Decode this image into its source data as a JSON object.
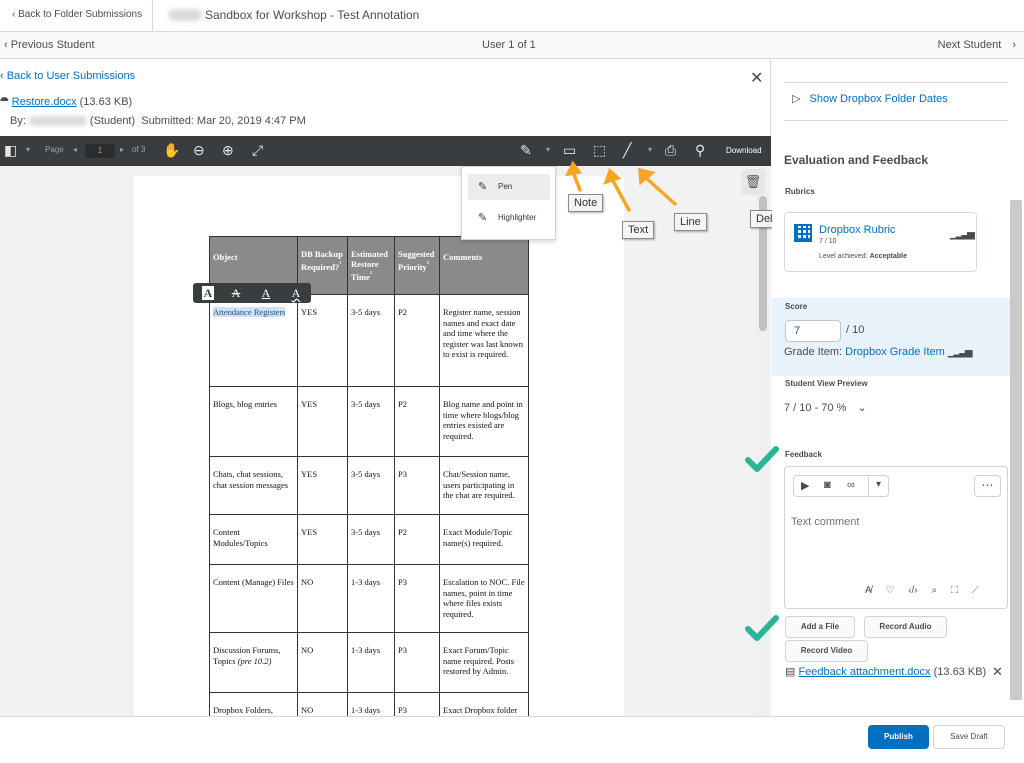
{
  "topbar": {
    "back_label": "Back to Folder Submissions",
    "course_title": "Sandbox for Workshop - Test Annotation"
  },
  "nav": {
    "prev_label": "Previous Student",
    "count_label": "User 1 of 1",
    "next_label": "Next Student"
  },
  "viewer": {
    "back_label": "Back to User Submissions",
    "file_name": "Restore.docx",
    "file_size": "(13.63 KB)",
    "by_label": "By:",
    "student_role": "(Student)",
    "submitted_label": "Submitted: Mar 20, 2019 4:47 PM",
    "toolbar": {
      "page_label": "Page",
      "page_value": "1",
      "page_of": "of 3",
      "download_label": "Download"
    },
    "pen_menu": [
      "Pen",
      "Highlighter"
    ],
    "callouts": {
      "note": "Note",
      "text": "Text",
      "line": "Line",
      "delete": "Delete"
    }
  },
  "doc_table": {
    "headers": [
      "Object",
      "DB Backup Required?",
      "Estimated Restore Time",
      "Suggested Priority",
      "Comments"
    ],
    "header_marks": [
      "",
      "¹",
      "²",
      "³",
      ""
    ],
    "rows": [
      [
        "Attendance Registers",
        "YES",
        "3-5 days",
        "P2",
        "Register name, session names and exact date and time where the register was last known to exist is required."
      ],
      [
        "Blogs, blog entries",
        "YES",
        "3-5 days",
        "P2",
        "Blog name and point in time where blogs/blog entries existed are required."
      ],
      [
        "Chats, chat sessions, chat session messages",
        "YES",
        "3-5 days",
        "P3",
        "Chat/Session name, users participating in the chat are required."
      ],
      [
        "Content Modules/Topics",
        "YES",
        "3-5 days",
        "P2",
        "Exact Module/Topic name(s) required."
      ],
      [
        "Content (Manage) Files",
        "NO",
        "1-3 days",
        "P3",
        "Escalation to NOC. File names, point in time where files exists required."
      ],
      [
        "Discussion Forums, Topics",
        "NO",
        "1-3 days",
        "P3",
        "Exact Forum/Topic name required.  Posts restored by Admin."
      ],
      [
        "Dropbox Folders,",
        "NO",
        "1-3 days",
        "P3",
        "Exact Dropbox folder"
      ]
    ],
    "row6_note": "(pre 10.2)"
  },
  "right": {
    "show_dates_label": "Show Dropbox Folder Dates",
    "eval_title": "Evaluation and Feedback",
    "rubrics_label": "Rubrics",
    "rubric_name": "Dropbox Rubric",
    "rubric_score": "7 / 10",
    "rubric_level_label": "Level achieved:",
    "rubric_level_value": "Acceptable",
    "score_label": "Score",
    "score_value": "7",
    "score_out_of": "/ 10",
    "grade_item_label": "Grade Item:",
    "grade_item_value": "Dropbox Grade Item",
    "student_view_label": "Student View Preview",
    "student_view_value": "7 / 10 - 70 %",
    "feedback_label": "Feedback",
    "feedback_placeholder": "Text comment",
    "add_file_label": "Add a File",
    "record_audio_label": "Record Audio",
    "record_video_label": "Record Video",
    "attachment_name": "Feedback attachment.docx",
    "attachment_size": "(13.63 KB)"
  },
  "footer": {
    "publish_label": "Publish",
    "save_draft_label": "Save Draft"
  },
  "colors": {
    "accent": "#006fbf",
    "callout_arrow": "#f5a623",
    "check": "#2bb596"
  }
}
